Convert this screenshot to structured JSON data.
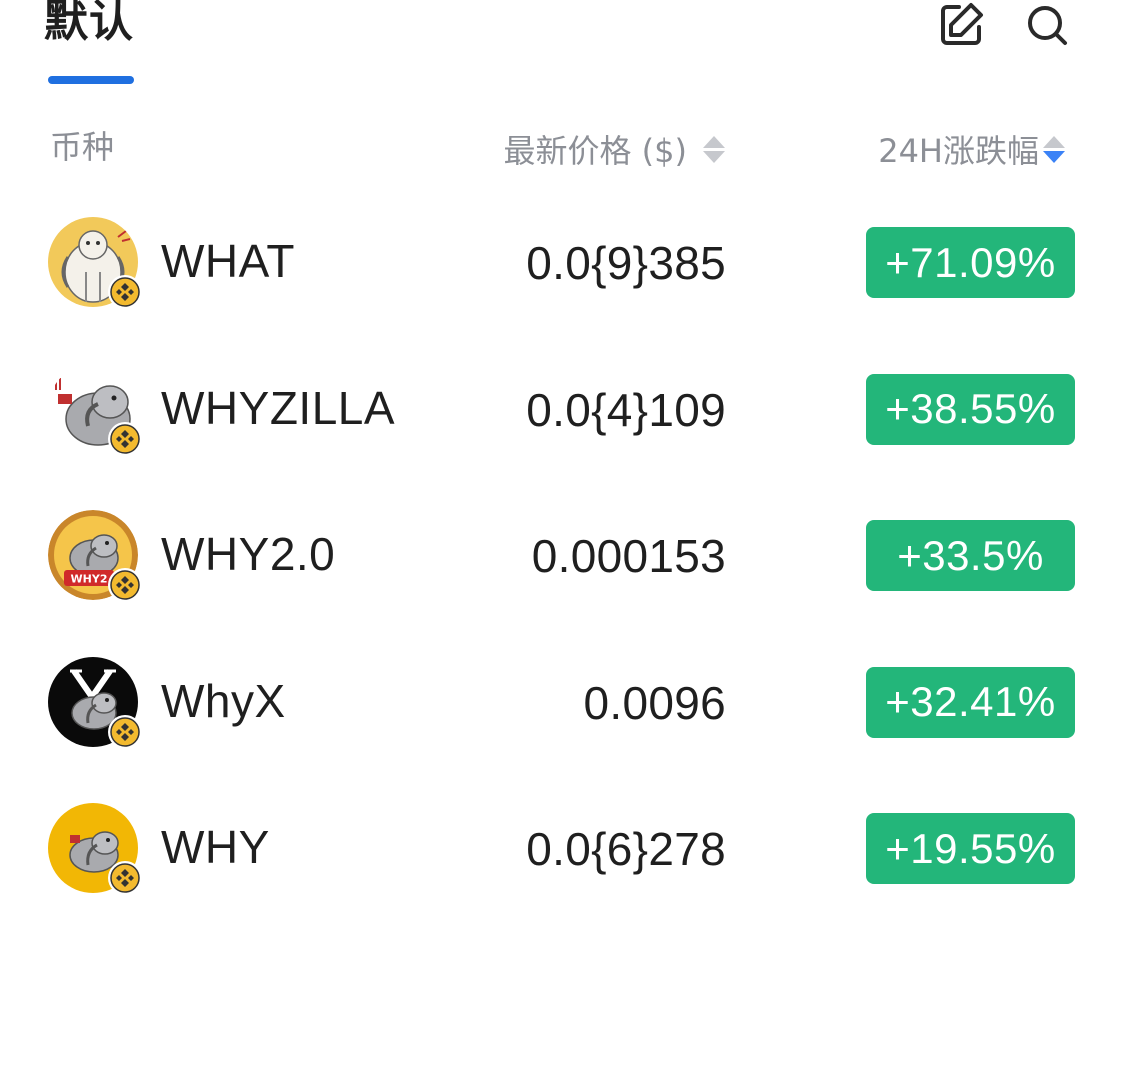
{
  "header": {
    "tab_label": "默认",
    "edit_icon": "edit-icon",
    "search_icon": "search-icon"
  },
  "columns": {
    "coin": "币种",
    "price": "最新价格 ($)",
    "change": "24H涨跌幅"
  },
  "colors": {
    "accent": "#1f6fe0",
    "positive": "#23b67a",
    "muted_text": "#8c8f96",
    "sort_active": "#3b82f6",
    "chain_badge": "#f3ba2f"
  },
  "rows": [
    {
      "symbol": "WHAT",
      "price": "0.0{9}385",
      "change": "+71.09%",
      "avatar": "what-avatar",
      "chain_icon": "bnb-chain-icon"
    },
    {
      "symbol": "WHYZILLA",
      "price": "0.0{4}109",
      "change": "+38.55%",
      "avatar": "whyzilla-avatar",
      "chain_icon": "bnb-chain-icon"
    },
    {
      "symbol": "WHY2.0",
      "price": "0.000153",
      "change": "+33.5%",
      "avatar": "why2-avatar",
      "avatar_text": "WHY2",
      "chain_icon": "bnb-chain-icon"
    },
    {
      "symbol": "WhyX",
      "price": "0.0096",
      "change": "+32.41%",
      "avatar": "whyx-avatar",
      "chain_icon": "bnb-chain-icon"
    },
    {
      "symbol": "WHY",
      "price": "0.0{6}278",
      "change": "+19.55%",
      "avatar": "why-avatar",
      "chain_icon": "bnb-chain-icon"
    }
  ]
}
